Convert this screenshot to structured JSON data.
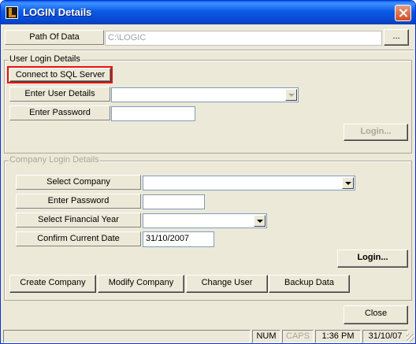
{
  "window": {
    "title": "LOGIN Details"
  },
  "path": {
    "label": "Path Of Data",
    "value": "C:\\LOGIC",
    "browse_label": "..."
  },
  "user_login": {
    "group_label": "User Login Details",
    "connect_button": "Connect to SQL Server",
    "user_label": "Enter User Details",
    "password_label": "Enter Password",
    "login_button": "Login..."
  },
  "company_login": {
    "group_label": "Company Login Details",
    "company_label": "Select Company",
    "password_label": "Enter Password",
    "year_label": "Select Financial Year",
    "date_label": "Confirm Current Date",
    "date_value": "31/10/2007",
    "login_button": "Login..."
  },
  "actions": {
    "create_company": "Create Company",
    "modify_company": "Modify Company",
    "change_user": "Change User",
    "backup_data": "Backup Data",
    "close": "Close"
  },
  "statusbar": {
    "num": "NUM",
    "caps": "CAPS",
    "time": "1:36 PM",
    "date": "31/10/07"
  },
  "highlight_color": "#E81010"
}
